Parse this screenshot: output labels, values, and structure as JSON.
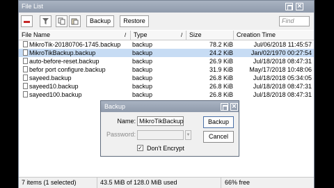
{
  "window": {
    "title": "File List"
  },
  "toolbar": {
    "backup_label": "Backup",
    "restore_label": "Restore",
    "find_placeholder": "Find"
  },
  "columns": {
    "name": "File Name",
    "type": "Type",
    "size": "Size",
    "time": "Creation Time"
  },
  "rows": [
    {
      "name": "MikroTik-20180706-1745.backup",
      "type": "backup",
      "size": "78.2 KiB",
      "time": "Jul/06/2018 11:45:57",
      "selected": false
    },
    {
      "name": "MikroTikBackup.backup",
      "type": "backup",
      "size": "24.2 KiB",
      "time": "Jan/02/1970 00:27:54",
      "selected": true
    },
    {
      "name": "auto-before-reset.backup",
      "type": "backup",
      "size": "26.9 KiB",
      "time": "Jul/18/2018 08:47:31",
      "selected": false
    },
    {
      "name": "befor port configure.backup",
      "type": "backup",
      "size": "31.9 KiB",
      "time": "May/17/2018 10:48:06",
      "selected": false
    },
    {
      "name": "sayeed.backup",
      "type": "backup",
      "size": "26.8 KiB",
      "time": "Jul/18/2018 05:34:05",
      "selected": false
    },
    {
      "name": "sayeed10.backup",
      "type": "backup",
      "size": "26.8 KiB",
      "time": "Jul/18/2018 08:47:31",
      "selected": false
    },
    {
      "name": "sayeed100.backup",
      "type": "backup",
      "size": "26.8 KiB",
      "time": "Jul/18/2018 08:47:31",
      "selected": false
    }
  ],
  "status": {
    "items": "7 items (1 selected)",
    "usage": "43.5 MiB of 128.0 MiB used",
    "free": "66% free"
  },
  "dialog": {
    "title": "Backup",
    "name_label": "Name:",
    "name_value": "MikroTikBackup",
    "password_label": "Password:",
    "dont_encrypt_label": "Don't Encrypt",
    "dont_encrypt_checked": true,
    "backup_button": "Backup",
    "cancel_button": "Cancel"
  }
}
